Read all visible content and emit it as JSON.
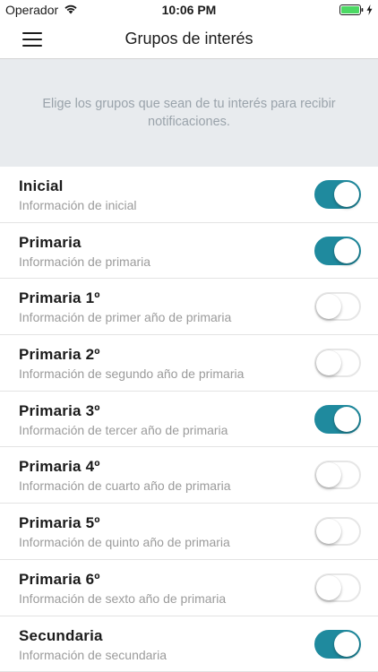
{
  "status_bar": {
    "carrier": "Operador",
    "time": "10:06 PM",
    "wifi_icon": "wifi-icon",
    "battery_icon": "battery-icon",
    "charging_icon": "charging-bolt-icon"
  },
  "nav": {
    "title": "Grupos de interés",
    "menu_icon": "hamburger-menu-icon"
  },
  "intro": {
    "text": "Elige los grupos que sean de tu interés para recibir notificaciones."
  },
  "colors": {
    "accent": "#1f8a9e",
    "intro_bg": "#e8ebee"
  },
  "groups": [
    {
      "title": "Inicial",
      "subtitle": "Información de inicial",
      "enabled": true
    },
    {
      "title": "Primaria",
      "subtitle": "Información de primaria",
      "enabled": true
    },
    {
      "title": "Primaria 1º",
      "subtitle": "Información de primer año de primaria",
      "enabled": false
    },
    {
      "title": "Primaria 2º",
      "subtitle": "Información de segundo año de primaria",
      "enabled": false
    },
    {
      "title": "Primaria 3º",
      "subtitle": "Información de tercer año de primaria",
      "enabled": true
    },
    {
      "title": "Primaria 4º",
      "subtitle": "Información de cuarto año de primaria",
      "enabled": false
    },
    {
      "title": "Primaria 5º",
      "subtitle": "Información de quinto año de primaria",
      "enabled": false
    },
    {
      "title": "Primaria 6º",
      "subtitle": "Información de sexto año de primaria",
      "enabled": false
    },
    {
      "title": "Secundaria",
      "subtitle": "Información de secundaria",
      "enabled": true
    }
  ]
}
